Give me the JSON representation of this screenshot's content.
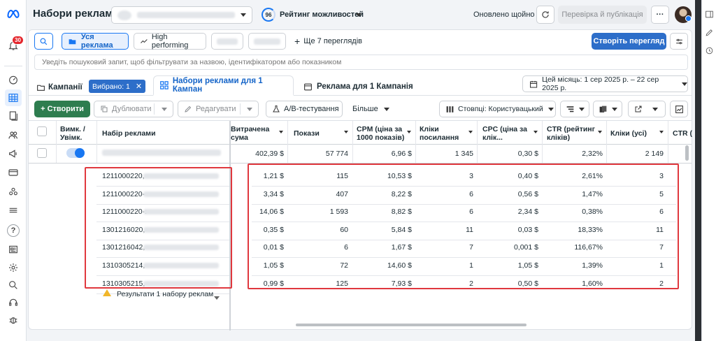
{
  "header": {
    "title": "Набори реклами",
    "opportunity_score": "96",
    "opportunity_label": "Рейтинг можливостей",
    "updated_status": "Оновлено щойно",
    "review_publish_label": "Перевірка й публікація",
    "more_label": "···"
  },
  "nav": {
    "notifications_badge": "30"
  },
  "toolbar": {
    "all_ads_label": "Уся реклама",
    "high_performing_label": "High performing",
    "more_views_label": "Ще 7 переглядів",
    "create_view_label": "Створіть перегляд",
    "search_placeholder": "Уведіть пошуковий запит, щоб фільтрувати за назвою, ідентифікатором або показником"
  },
  "tabs": {
    "campaigns_label": "Кампанії",
    "selected_chip": "Вибрано: 1",
    "adsets_label": "Набори реклами для 1 Кампан",
    "ads_label": "Реклама для 1 Кампанія",
    "date_range": "Цей місяць: 1 сер 2025 р. – 22 сер 2025 р."
  },
  "actions": {
    "create_label": "+ Створити",
    "duplicate_label": "Дублювати",
    "edit_label": "Редагувати",
    "ab_test_label": "A/B-тестування",
    "more_label": "Більше",
    "columns_label": "Стовпці: Користувацький"
  },
  "table": {
    "headers": {
      "toggle": [
        "Вимк. /",
        "Увімк."
      ],
      "name": "Набір реклами",
      "spend": [
        "Витрачена",
        "сума"
      ],
      "impressions": "Покази",
      "cpm": [
        "CPM (ціна за",
        "1000 показів)"
      ],
      "link_clicks": [
        "Кліки",
        "посилання"
      ],
      "cpc": [
        "CPC (ціна за",
        "клік..."
      ],
      "ctr": [
        "CTR (рейтинг",
        "кліків)"
      ],
      "clicks_all": "Кліки (усі)",
      "ctr_more": "CTR ("
    },
    "summary": {
      "spend": "402,39 $",
      "impressions": "57 774",
      "cpm": "6,96 $",
      "link_clicks": "1 345",
      "cpc": "0,30 $",
      "ctr": "2,32%",
      "clicks_all": "2 149"
    },
    "rows": [
      {
        "id": "1211000220,",
        "spend": "1,21 $",
        "impressions": "115",
        "cpm": "10,53 $",
        "link_clicks": "3",
        "cpc": "0,40 $",
        "ctr": "2,61%",
        "clicks_all": "3"
      },
      {
        "id": "1211000220-",
        "spend": "3,34 $",
        "impressions": "407",
        "cpm": "8,22 $",
        "link_clicks": "6",
        "cpc": "0,56 $",
        "ctr": "1,47%",
        "clicks_all": "5"
      },
      {
        "id": "1211000220-:",
        "spend": "14,06 $",
        "impressions": "1 593",
        "cpm": "8,82 $",
        "link_clicks": "6",
        "cpc": "2,34 $",
        "ctr": "0,38%",
        "clicks_all": "6"
      },
      {
        "id": "1301216020,",
        "spend": "0,35 $",
        "impressions": "60",
        "cpm": "5,84 $",
        "link_clicks": "11",
        "cpc": "0,03 $",
        "ctr": "18,33%",
        "clicks_all": "11"
      },
      {
        "id": "1301216042,",
        "spend": "0,01 $",
        "impressions": "6",
        "cpm": "1,67 $",
        "link_clicks": "7",
        "cpc": "0,001 $",
        "ctr": "116,67%",
        "clicks_all": "7"
      },
      {
        "id": "1310305214,",
        "spend": "1,05 $",
        "impressions": "72",
        "cpm": "14,60 $",
        "link_clicks": "1",
        "cpc": "1,05 $",
        "ctr": "1,39%",
        "clicks_all": "1"
      },
      {
        "id": "1310305215,",
        "spend": "0,99 $",
        "impressions": "125",
        "cpm": "7,93 $",
        "link_clicks": "2",
        "cpc": "0,50 $",
        "ctr": "1,60%",
        "clicks_all": "2"
      }
    ],
    "footer_results": "Результати 1 набору реклам"
  },
  "colors": {
    "accent": "#1877f2",
    "primary_button": "#2d6ec9",
    "create_button": "#2e7d4f",
    "highlight": "#e0383e",
    "badge": "#e4262c"
  }
}
